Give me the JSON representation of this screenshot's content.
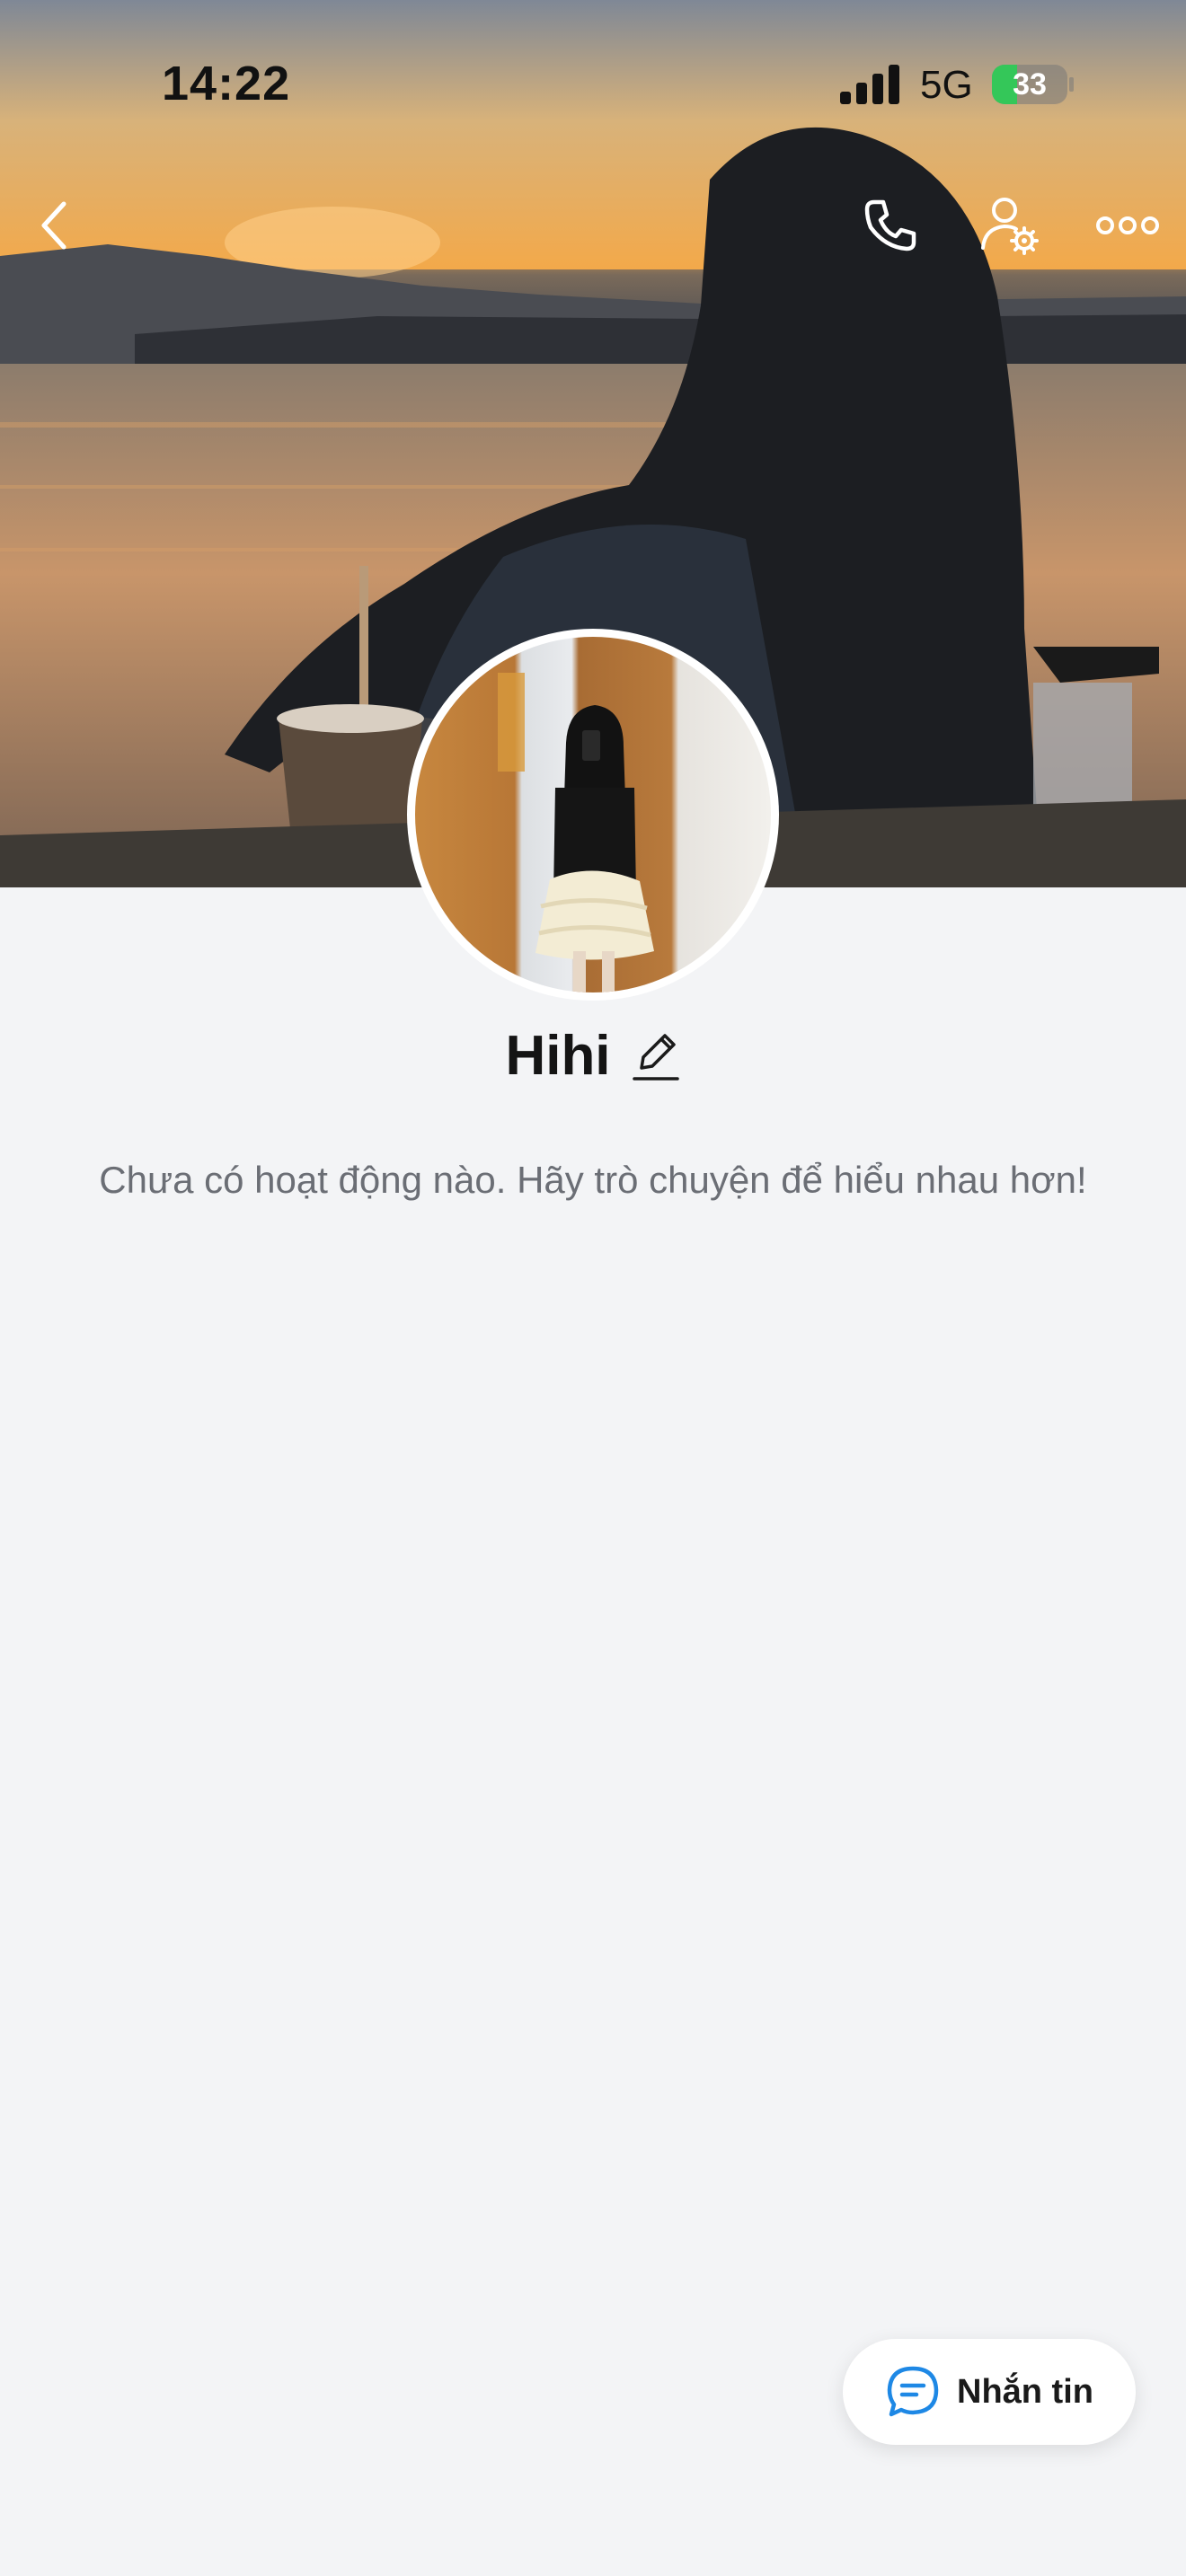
{
  "status_bar": {
    "time": "14:22",
    "network": "5G",
    "battery_percent": 33,
    "battery_label": "33",
    "battery_color": "#34c759"
  },
  "header": {
    "back_icon": "chevron-left-icon",
    "call_icon": "phone-icon",
    "settings_icon": "user-settings-icon",
    "more_icon": "more-horizontal-icon"
  },
  "profile": {
    "name": "Hihi",
    "edit_icon": "pencil-icon",
    "empty_message": "Chưa có hoạt động nào. Hãy trò chuyện để hiểu nhau hơn!"
  },
  "actions": {
    "message_label": "Nhắn tin",
    "message_icon": "chat-bubble-icon",
    "accent_color": "#1e88e5"
  }
}
